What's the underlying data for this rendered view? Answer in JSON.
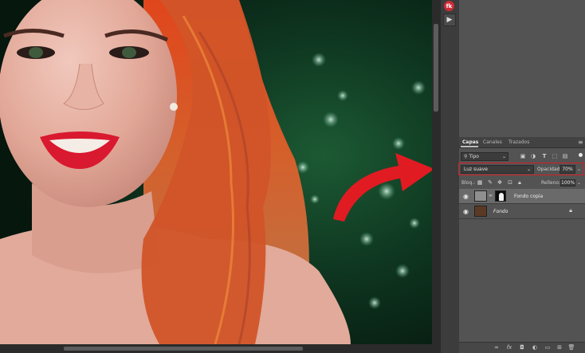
{
  "app": {
    "logo_text": "fk"
  },
  "panel": {
    "tabs": [
      {
        "label": "Capas",
        "active": true
      },
      {
        "label": "Canales",
        "active": false
      },
      {
        "label": "Trazados",
        "active": false
      }
    ],
    "filter": {
      "label": "Tipo",
      "icons": [
        "pixel-filter-icon",
        "adjustment-filter-icon",
        "type-filter-icon",
        "shape-filter-icon",
        "smart-object-filter-icon"
      ]
    },
    "blend_mode": "Luz suave",
    "opacity_label": "Opacidad:",
    "opacity_value": "70%",
    "lock_label": "Bloq.:",
    "fill_label": "Relleno:",
    "fill_value": "100%",
    "layers": [
      {
        "name": "Fondo copia",
        "selected": true,
        "has_mask": true,
        "locked": false
      },
      {
        "name": "Fondo",
        "selected": false,
        "has_mask": false,
        "locked": true
      }
    ],
    "bottom_icons": [
      "link-layers-icon",
      "fx-icon",
      "add-mask-icon",
      "adjustment-layer-icon",
      "group-icon",
      "new-layer-icon",
      "trash-icon"
    ],
    "bottom_fx_label": "fx"
  },
  "colors": {
    "highlight_red": "#d41f26",
    "panel_bg": "#535353",
    "selected_layer": "#6a6a6a",
    "lips": "#d9192f",
    "hair": "#d4552a"
  }
}
